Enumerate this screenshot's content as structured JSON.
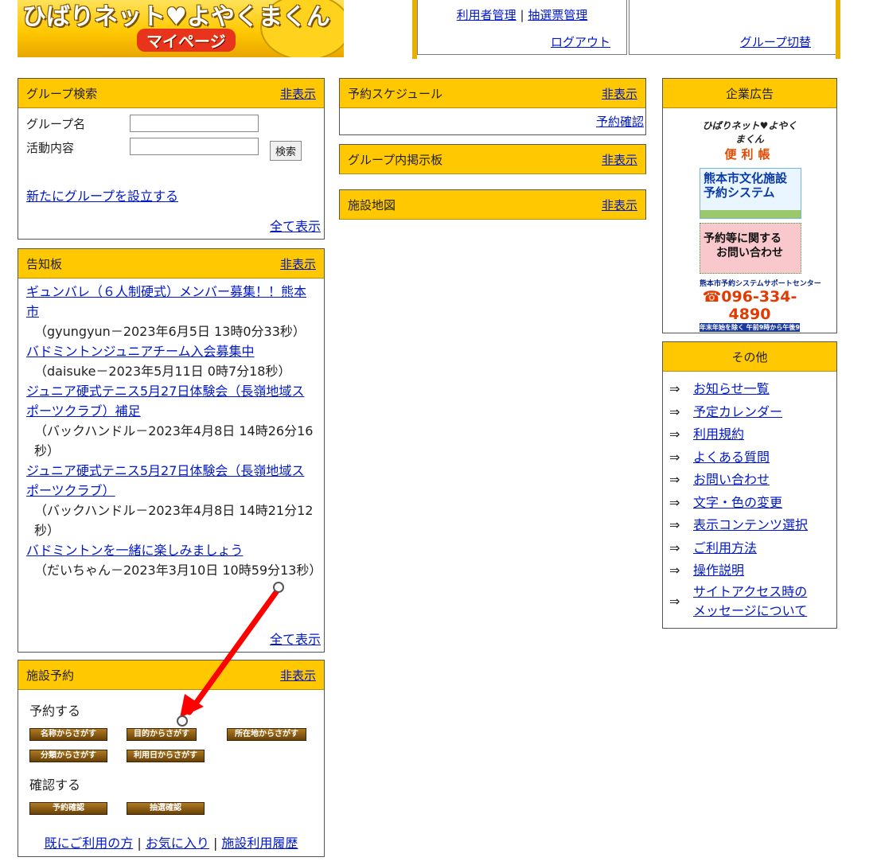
{
  "header": {
    "logo_title": "ひばりネット♥よやくまくん",
    "logo_sub": "マイページ",
    "user_mgmt": "利用者管理",
    "separator": "|",
    "lottery_mgmt": "抽選票管理",
    "logout": "ログアウト",
    "group_switch": "グループ切替"
  },
  "group_search": {
    "title": "グループ検索",
    "hide": "非表示",
    "name_label": "グループ名",
    "activity_label": "活動内容",
    "name_value": "",
    "activity_value": "",
    "search_button": "検索",
    "create_link": "新たにグループを設立する",
    "show_all": "全て表示"
  },
  "notice_board": {
    "title": "告知板",
    "hide": "非表示",
    "items": [
      {
        "title": "ギュンバレ（６人制硬式）メンバー募集！！熊本市",
        "meta": "（gyungyun－2023年6月5日 13時0分33秒）"
      },
      {
        "title": "バドミントンジュニアチーム入会募集中",
        "meta": "（daisuke－2023年5月11日 0時7分18秒）"
      },
      {
        "title": "ジュニア硬式テニス5月27日体験会（長嶺地域スポーツクラブ）補足",
        "meta": "（バックハンドル－2023年4月8日 14時26分16秒）"
      },
      {
        "title": "ジュニア硬式テニス5月27日体験会（長嶺地域スポーツクラブ）",
        "meta": "（バックハンドル－2023年4月8日 14時21分12秒）"
      },
      {
        "title": "バドミントンを一緒に楽しみましょう",
        "meta": "（だいちゃん－2023年3月10日 10時59分13秒）"
      }
    ],
    "show_all": "全て表示"
  },
  "facility_reservation": {
    "title": "施設予約",
    "hide": "非表示",
    "reserve_heading": "予約する",
    "buttons": [
      "名称からさがす",
      "目的からさがす",
      "所在地からさがす",
      "分類からさがす",
      "利用日からさがす"
    ],
    "confirm_heading": "確認する",
    "confirm_buttons": [
      "予約確認",
      "抽選確認"
    ],
    "footer_links": [
      "既にご利用の方",
      "お気に入り",
      "施設利用履歴"
    ],
    "separator": "|"
  },
  "schedule": {
    "title": "予約スケジュール",
    "hide": "非表示",
    "confirm": "予約確認"
  },
  "group_board": {
    "title": "グループ内掲示板",
    "hide": "非表示"
  },
  "facility_map": {
    "title": "施設地図",
    "hide": "非表示"
  },
  "ads": {
    "title": "企業広告",
    "banner1_line1": "ひばりネット♥よやくまくん",
    "banner1_line2": "便利帳",
    "banner2_line1": "熊本市文化施設",
    "banner2_line2": "予約システム",
    "banner3_line1": "予約等に関する",
    "banner3_line2": "お問い合わせ",
    "banner4_line1": "熊本市予約システムサポートセンター",
    "banner4_phone": "096-334-4890",
    "banner4_line3": "年末年始を除く 午前9時から午後9時"
  },
  "other": {
    "title": "その他",
    "arrow": "⇒",
    "items": [
      "お知らせ一覧",
      "予定カレンダー",
      "利用規約",
      "よくある質問",
      "お問い合わせ",
      "文字・色の変更",
      "表示コンテンツ選択",
      "ご利用方法",
      "操作説明",
      "サイトアクセス時のメッセージについて"
    ]
  },
  "colors": {
    "header_yellow": "#ffc800",
    "link_blue": "#0018c8",
    "annotation_arrow": "#ff0000"
  }
}
